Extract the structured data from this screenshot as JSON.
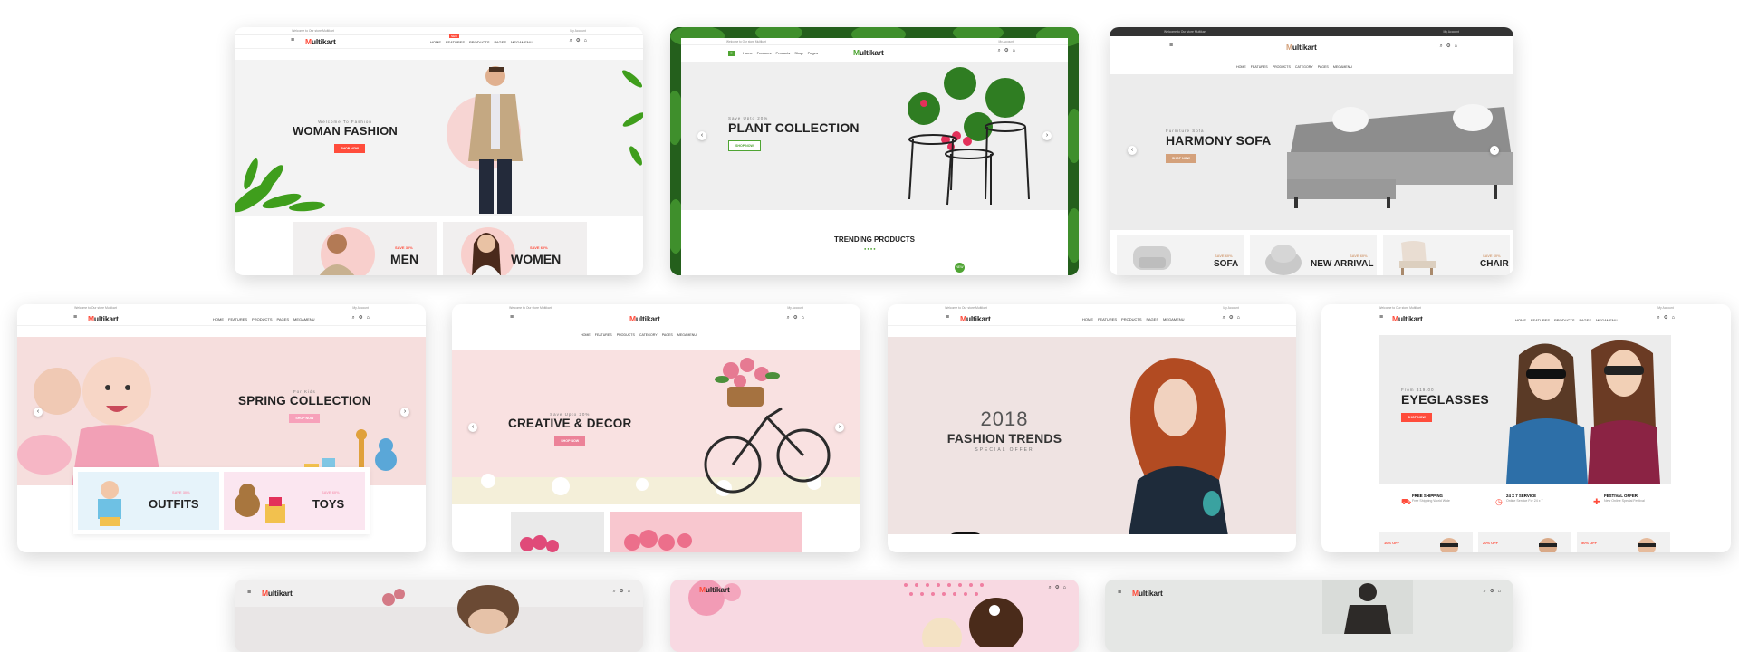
{
  "accent": "#ff4c3b",
  "top_strip": {
    "welcome": "Welcome to Our store Multikart",
    "phone": "Call Us: 123 - 456 - 7890",
    "wishlist": "♥ wishlist",
    "account": "My Account"
  },
  "common": {
    "logo_m": "M",
    "logo_rest": "ultikart",
    "burger": "≡",
    "search_icon": "⌕",
    "settings_icon": "⚙",
    "cart_icon": "⌂"
  },
  "demos": {
    "fashion": {
      "menu": [
        "HOME",
        "FEATURES",
        "PRODUCTS",
        "PAGES",
        "MEGAMENU"
      ],
      "new_badge": "NEW",
      "eyebrow": "Welcome To Fashion",
      "title": "WOMAN FASHION",
      "button": "SHOP NOW",
      "banners": [
        {
          "save": "SAVE 30%",
          "label": "MEN"
        },
        {
          "save": "SAVE 60%",
          "label": "WOMEN"
        }
      ]
    },
    "plant": {
      "menu": [
        "Home",
        "Features",
        "Products",
        "Shop",
        "Pages"
      ],
      "eyebrow": "Save Upto 20%",
      "title": "PLANT COLLECTION",
      "button": "SHOP NOW",
      "section": "TRENDING PRODUCTS",
      "new_badge": "NEW"
    },
    "furniture": {
      "menu": [
        "HOME",
        "FEATURES",
        "PRODUCTS",
        "CATEGORY",
        "PAGES",
        "MEGAMENU"
      ],
      "eyebrow": "Furniture Sofa",
      "title": "HARMONY SOFA",
      "button": "SHOP NOW",
      "banners": [
        {
          "save": "SAVE 60%",
          "label": "SOFA"
        },
        {
          "save": "SAVE 60%",
          "label": "NEW ARRIVAL"
        },
        {
          "save": "SAVE 60%",
          "label": "CHAIR"
        }
      ]
    },
    "kids": {
      "menu": [
        "HOME",
        "FEATURES",
        "PRODUCTS",
        "PAGES",
        "MEGAMENU"
      ],
      "eyebrow": "For Kids",
      "title": "SPRING COLLECTION",
      "button": "SHOP NOW",
      "banners": [
        {
          "save": "SAVE 30%",
          "label": "OUTFITS"
        },
        {
          "save": "SAVE 60%",
          "label": "TOYS"
        }
      ]
    },
    "decor": {
      "menu": [
        "HOME",
        "FEATURES",
        "PRODUCTS",
        "CATEGORY",
        "PAGES",
        "MEGAMENU"
      ],
      "eyebrow": "Save Upto 20%",
      "title": "CREATIVE & DECOR",
      "button": "SHOP NOW"
    },
    "trends": {
      "menu": [
        "HOME",
        "FEATURES",
        "PRODUCTS",
        "PAGES",
        "MEGAMENU"
      ],
      "year": "2018",
      "title": "FASHION TRENDS",
      "subtitle": "SPECIAL OFFER"
    },
    "eyewear": {
      "menu": [
        "HOME",
        "FEATURES",
        "PRODUCTS",
        "PAGES",
        "MEGAMENU"
      ],
      "eyebrow": "From $19.00",
      "title": "EYEGLASSES",
      "button": "SHOP NOW",
      "services": [
        {
          "title": "FREE SHIPPING",
          "sub": "Free Shipping World Wide"
        },
        {
          "title": "24 X 7 SERVICE",
          "sub": "Online Service For 24 x 7"
        },
        {
          "title": "FESTIVAL OFFER",
          "sub": "New Online Special Festival"
        }
      ],
      "offers": [
        "10% OFF",
        "20% OFF",
        "50% OFF"
      ]
    }
  }
}
